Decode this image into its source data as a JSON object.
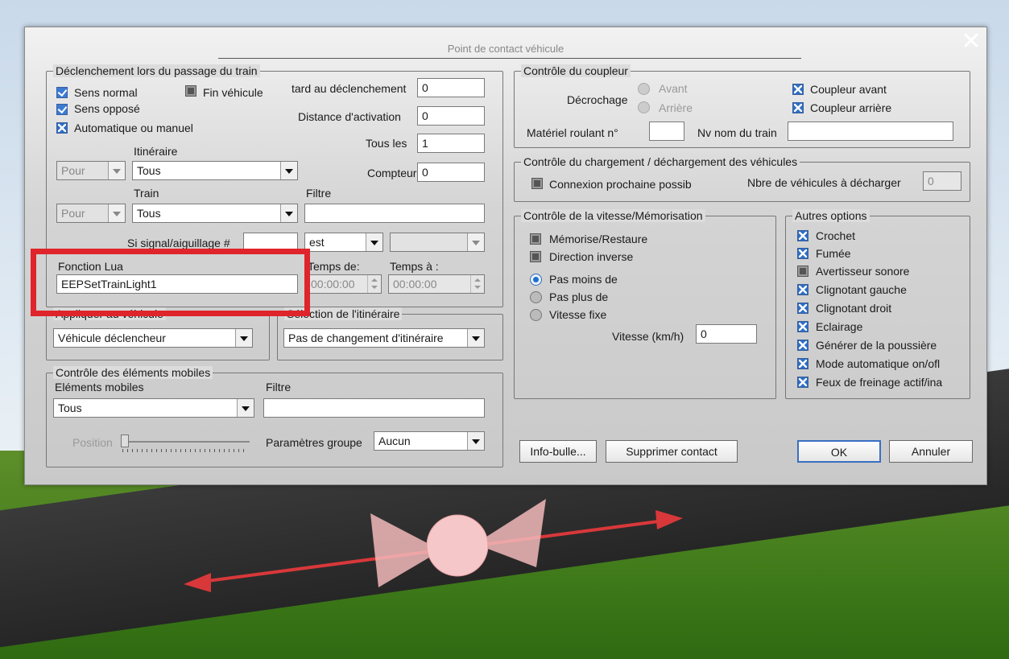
{
  "window": {
    "title": "Point de contact véhicule",
    "close_glyph": "✕"
  },
  "trigger": {
    "legend": "Déclenchement lors du passage du train",
    "sens_normal": "Sens normal",
    "fin_vehicule": "Fin véhicule",
    "sens_oppose": "Sens opposé",
    "auto_manuel": "Automatique ou manuel",
    "retard_label": "tard au déclenchement",
    "retard_value": "0",
    "distance_label": "Distance d'activation",
    "distance_value": "0",
    "tous_les_label": "Tous les",
    "tous_les_value": "1",
    "compteur_label": "Compteur",
    "compteur_value": "0",
    "itineraire_label": "Itinéraire",
    "pour1": "Pour",
    "itineraire_value": "Tous",
    "train_label": "Train",
    "filtre_label": "Filtre",
    "pour2": "Pour",
    "train_value": "Tous",
    "filtre_value": "",
    "signal_label": "Si signal/aiguillage #",
    "signal_value": "",
    "est_value": "est",
    "etat_value": "",
    "lua_label": "Fonction Lua",
    "lua_value": "EEPSetTrainLight1",
    "temps_de_label": "Temps de:",
    "temps_de_value": "00:00:00",
    "temps_a_label": "Temps à :",
    "temps_a_value": "00:00:00"
  },
  "applique": {
    "legend": "Appliquer au véhicule",
    "value": "Véhicule déclencheur"
  },
  "selection_itin": {
    "legend": "Sélection de l'itinéraire",
    "value": "Pas de changement d'itinéraire"
  },
  "mobiles": {
    "legend": "Contrôle des éléments mobiles",
    "elements_label": "Eléments mobiles",
    "elements_value": "Tous",
    "filtre_label": "Filtre",
    "filtre_value": "",
    "position_label": "Position",
    "groupe_label": "Paramètres groupe",
    "groupe_value": "Aucun"
  },
  "coupleur": {
    "legend": "Contrôle du coupleur",
    "decrochage_label": "Décrochage",
    "avant": "Avant",
    "arriere": "Arrière",
    "coupleur_avant": "Coupleur avant",
    "coupleur_arriere": "Coupleur arrière",
    "materiel_label": "Matériel roulant n°",
    "materiel_value": "",
    "nv_nom_label": "Nv nom du train",
    "nv_nom_value": ""
  },
  "chargement": {
    "legend": "Contrôle du chargement / déchargement des véhicules",
    "connexion": "Connexion prochaine possib",
    "nbre_label": "Nbre de véhicules à décharger",
    "nbre_value": "0"
  },
  "vitesse": {
    "legend": "Contrôle de la vitesse/Mémorisation",
    "memorise": "Mémorise/Restaure",
    "direction": "Direction inverse",
    "pas_moins": "Pas moins de",
    "pas_plus": "Pas plus de",
    "vitesse_fixe": "Vitesse fixe",
    "vitesse_label": "Vitesse (km/h)",
    "vitesse_value": "0"
  },
  "autres": {
    "legend": "Autres options",
    "items": [
      "Crochet",
      "Fumée",
      "Avertisseur sonore",
      "Clignotant gauche",
      "Clignotant droit",
      "Eclairage",
      "Générer de la poussière",
      "Mode automatique on/ofl",
      "Feux de freinage actif/ina"
    ]
  },
  "buttons": {
    "info": "Info-bulle...",
    "supprimer": "Supprimer contact",
    "ok": "OK",
    "annuler": "Annuler"
  },
  "colors": {
    "highlight_box": "#e0242b",
    "checkbox_accent": "#2e6fc5"
  }
}
